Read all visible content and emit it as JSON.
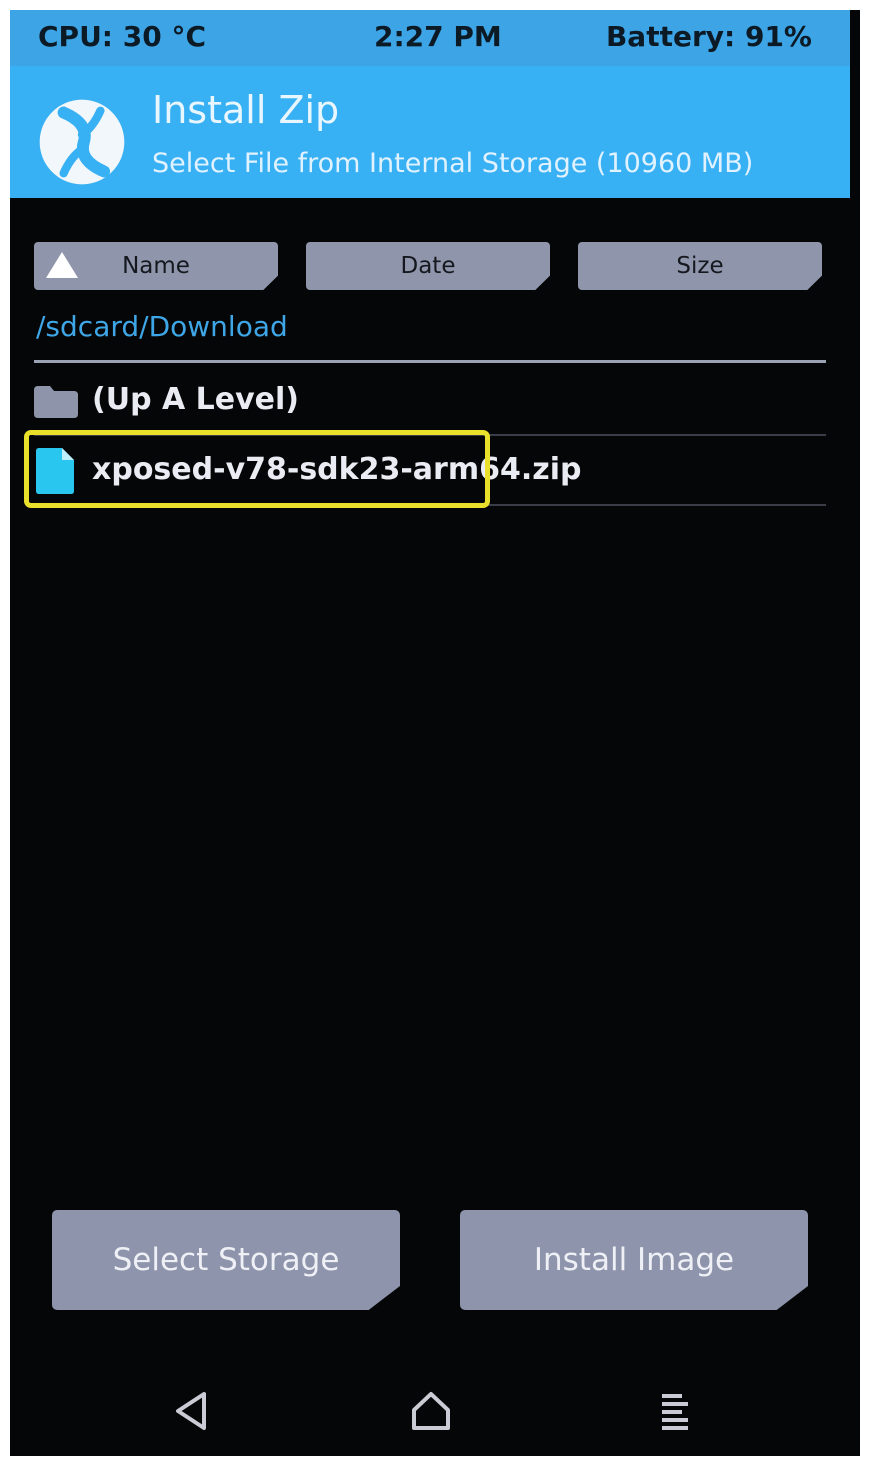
{
  "status": {
    "cpu": "CPU: 30 °C",
    "time": "2:27 PM",
    "battery": "Battery: 91%"
  },
  "header": {
    "title": "Install Zip",
    "subtitle": "Select File from Internal Storage (10960 MB)",
    "logo_icon": "twrp-logo-icon"
  },
  "sort": {
    "name_label": "Name",
    "date_label": "Date",
    "size_label": "Size",
    "active": "Name",
    "direction_icon": "triangle-up-icon"
  },
  "path": "/sdcard/Download",
  "files": [
    {
      "label": "(Up A Level)",
      "icon": "folder-icon"
    },
    {
      "label": "xposed-v78-sdk23-arm64.zip",
      "icon": "file-icon",
      "highlighted": true
    }
  ],
  "actions": {
    "select_storage": "Select Storage",
    "install_image": "Install Image"
  },
  "nav": {
    "back_icon": "back-icon",
    "home_icon": "home-icon",
    "menu_icon": "menu-icon"
  },
  "colors": {
    "header_blue": "#38b0f4",
    "status_blue": "#3da4e6",
    "button_gray": "#8d94ab",
    "path_blue": "#3ea6e6",
    "file_cyan": "#29c6f0",
    "highlight_yellow": "#e8e02a",
    "background": "#050607"
  }
}
